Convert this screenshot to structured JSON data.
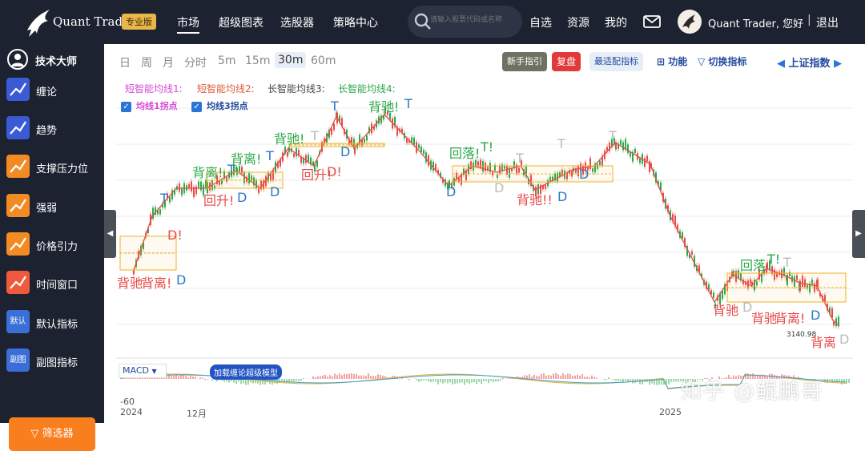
{
  "header": {
    "brand": "Quant Trader",
    "badge": "专业版",
    "nav": [
      "市场",
      "超级图表",
      "选股器",
      "策略中心"
    ],
    "search_placeholder": "请输入股票代码或名称",
    "links": [
      "自选",
      "资源",
      "我的"
    ],
    "greeting": "Quant Trader, 您好",
    "separator": "|",
    "logout": "退出"
  },
  "sidebar": {
    "title": "技术大师",
    "items": [
      {
        "label": "缠论",
        "icon": "chanlun-icon",
        "color": "#3b5bd6"
      },
      {
        "label": "趋势",
        "icon": "trend-icon",
        "color": "#3b5bd6"
      },
      {
        "label": "支撑压力位",
        "icon": "support-resistance-icon",
        "color": "#f28b24"
      },
      {
        "label": "强弱",
        "icon": "strength-icon",
        "color": "#f28b24"
      },
      {
        "label": "价格引力",
        "icon": "price-gravity-icon",
        "color": "#f28b24"
      },
      {
        "label": "时间窗口",
        "icon": "time-window-icon",
        "color": "#f05a3c"
      },
      {
        "label": "默认指标",
        "icon": "default-indicator-icon",
        "icon_text": "默认",
        "color": "#3b6ed6"
      },
      {
        "label": "副图指标",
        "icon": "sub-indicator-icon",
        "icon_text": "副图",
        "color": "#3b6ed6"
      }
    ],
    "filter_button": "筛选器"
  },
  "toolbar": {
    "timeframes": [
      "日",
      "周",
      "月",
      "分时",
      "5m",
      "15m",
      "30m",
      "60m"
    ],
    "active_timeframe": "30m",
    "beginner_guide": "新手指引",
    "review": "复盘",
    "best_indicator": "最适配指标",
    "functions": "功能",
    "switch_indicator": "切换指标",
    "index_name": "上证指数"
  },
  "chart": {
    "legend": [
      {
        "label": "短智能均线1:",
        "color": "#d64ad6"
      },
      {
        "label": "短智能均线2:",
        "color": "#e05c3c"
      },
      {
        "label": "长智能均线3:",
        "color": "#444444"
      },
      {
        "label": "长智能均线4:",
        "color": "#2ca84a"
      }
    ],
    "checkbox1": "均线1拐点",
    "checkbox2": "均线3拐点",
    "price_label": "3140.98",
    "macd_label": "MACD",
    "macd_button": "加载缠论超级模型",
    "macd_axis_min": "-60",
    "x_axis_ticks": [
      "2024",
      "12月",
      "2025"
    ],
    "watermark": "知乎 @鲲鹏哥",
    "colors": {
      "up": "#e84a4a",
      "down": "#2ca84a",
      "bi_line": "#e84a4a",
      "box": "#f2b020",
      "top_label": "#2ca84a",
      "bottom_label": "#2a7ac8"
    },
    "annotations": [
      "背驰",
      "背离!",
      "D",
      "D!",
      "T",
      "回升!",
      "D",
      "背离!",
      "T",
      "背离!",
      "T",
      "D",
      "背驰!",
      "T",
      "回升!",
      "D!",
      "T",
      "D",
      "背驰!",
      "T",
      "回落!",
      "T!",
      "D",
      "D",
      "T",
      "背驰!!",
      "D",
      "T",
      "D",
      "T",
      "回落",
      "T!",
      "T",
      "背驰",
      "D",
      "背驰",
      "背离!",
      "D",
      "背离",
      "D"
    ]
  }
}
